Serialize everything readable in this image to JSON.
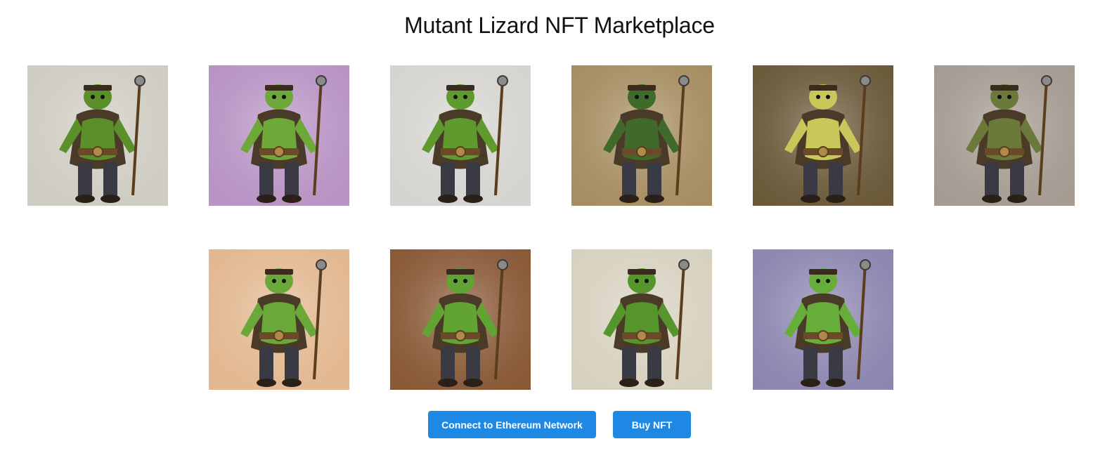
{
  "page": {
    "title": "Mutant Lizard NFT Marketplace"
  },
  "gallery": {
    "rows": [
      [
        {
          "icon": "lizard-warrior-nft-image",
          "bg": "#cfccc3",
          "accent": "#5a8f2a"
        },
        {
          "icon": "lizard-adventurer-nft-image",
          "bg": "#b894c4",
          "accent": "#6ea83a"
        },
        {
          "icon": "lizard-swordsman-nft-image",
          "bg": "#d6d4d0",
          "accent": "#5e9a2e"
        },
        {
          "icon": "lizard-archer-nft-image",
          "bg": "#a78e62",
          "accent": "#3f6a2a"
        },
        {
          "icon": "lizard-mechanic-nft-image",
          "bg": "#6b5a3a",
          "accent": "#c8c85a"
        },
        {
          "icon": "lizard-blacksmith-nft-image",
          "bg": "#a59b92",
          "accent": "#6b7a3a"
        }
      ],
      [
        {
          "icon": "lizard-trio-nft-image",
          "bg": "#e2b890",
          "accent": "#6aa83a"
        },
        {
          "icon": "lizard-scout-nft-image",
          "bg": "#8a5a38",
          "accent": "#62a434"
        },
        {
          "icon": "lizard-gladiator-nft-image",
          "bg": "#d7d1c0",
          "accent": "#55952c"
        },
        {
          "icon": "lizard-engineer-nft-image",
          "bg": "#8d87b0",
          "accent": "#67ad3a"
        }
      ]
    ]
  },
  "actions": {
    "connect_label": "Connect to Ethereum Network",
    "buy_label": "Buy NFT"
  },
  "colors": {
    "primary_button": "#1e88e5",
    "button_text": "#ffffff",
    "title_text": "#111111"
  }
}
